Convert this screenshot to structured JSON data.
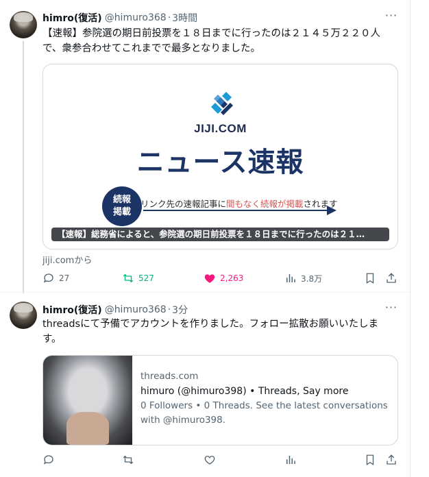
{
  "tweets": [
    {
      "user": {
        "name": "himro(復活)",
        "handle": "@himuro368",
        "time": "3時間"
      },
      "more_label": "···",
      "text_line1": "【速報】参院選の期日前投票を１８日までに行ったのは２１４５万２２０人",
      "text_line2": "で、衆参合わせてこれまでで最多となりました。",
      "card": {
        "logo_text": "JIJI.COM",
        "headline": "ニュース速報",
        "badge_line1": "続報",
        "badge_line2": "掲載",
        "notice_a": "リンク先の速報記事に",
        "notice_b": "間もなく続報が掲載",
        "notice_c": "されます",
        "caption": "【速報】総務省によると、参院選の期日前投票を１８日までに行ったのは２１…"
      },
      "source": "jiji.comから",
      "actions": {
        "replies": "27",
        "retweets": "527",
        "likes": "2,263",
        "views": "3.8万"
      }
    },
    {
      "user": {
        "name": "himro(復活)",
        "handle": "@himuro368",
        "time": "3分"
      },
      "more_label": "···",
      "text_line1": "threadsにて予備でアカウントを作りました。フォロー拡散お願いいたしま",
      "text_line2": "す。",
      "link_card": {
        "domain": "threads.com",
        "title": "himuro (@himuro398) • Threads, Say more",
        "desc_line1": "0 Followers • 0 Threads. See the latest conversations",
        "desc_line2": "with @himuro398."
      }
    }
  ],
  "colors": {
    "accent_blue": "#1d9bf0",
    "retweet_green": "#00ba7c",
    "like_pink": "#f91880",
    "jiji_navy": "#1c3366",
    "notice_red": "#d9534f"
  },
  "icons": [
    "more-icon",
    "reply-icon",
    "retweet-icon",
    "like-icon",
    "views-icon",
    "bookmark-icon",
    "share-icon",
    "jiji-logo-icon"
  ]
}
